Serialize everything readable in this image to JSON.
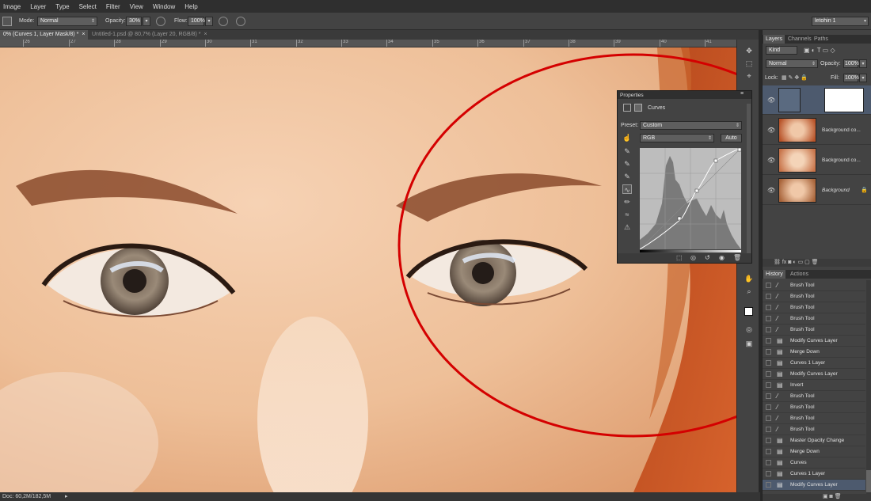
{
  "menu": [
    "Image",
    "Layer",
    "Type",
    "Select",
    "Filter",
    "View",
    "Window",
    "Help"
  ],
  "options": {
    "mode_label": "Mode:",
    "mode_value": "Normal",
    "opacity_label": "Opacity:",
    "opacity_value": "30%",
    "flow_label": "Flow:",
    "flow_value": "100%",
    "workspace": "letohin 1"
  },
  "tabs": [
    {
      "label": "0% (Curves 1, Layer Mask/8) *",
      "close": "×"
    },
    {
      "label": "Untitled-1.psd @ 80,7% (Layer 20, RGB/8) *",
      "close": "×"
    }
  ],
  "ruler_ticks": [
    "26",
    "27",
    "28",
    "29",
    "30",
    "31",
    "32",
    "33",
    "34",
    "35",
    "36",
    "37",
    "38",
    "39",
    "40",
    "41"
  ],
  "status": {
    "doc": "Doc: 60,2M/182,5M",
    "arrow": "▸"
  },
  "layers_panel": {
    "tabs": [
      "Layers",
      "Channels",
      "Paths"
    ],
    "kind": "Kind",
    "blend": "Normal",
    "opacity_label": "Opacity:",
    "opacity_value": "100%",
    "lock_label": "Lock:",
    "fill_label": "Fill:",
    "fill_value": "100%",
    "layers": [
      {
        "name": ""
      },
      {
        "name": "Background co..."
      },
      {
        "name": "Background co..."
      },
      {
        "name": "Background"
      }
    ]
  },
  "history_panel": {
    "tabs": [
      "History",
      "Actions"
    ],
    "items": [
      "Brush Tool",
      "Brush Tool",
      "Brush Tool",
      "Brush Tool",
      "Brush Tool",
      "Modify Curves Layer",
      "Merge Down",
      "Curves 1 Layer",
      "Modify Curves Layer",
      "Invert",
      "Brush Tool",
      "Brush Tool",
      "Brush Tool",
      "Brush Tool",
      "Master Opacity Change",
      "Merge Down",
      "Curves",
      "Curves 1 Layer",
      "Modify Curves Layer"
    ]
  },
  "properties": {
    "title": "Properties",
    "adjustment": "Curves",
    "preset_label": "Preset:",
    "preset_value": "Custom",
    "channel": "RGB",
    "auto": "Auto"
  },
  "colors": {
    "annotation_circle": "#d40000",
    "panel_bg": "#434343",
    "selected_row": "#4d5a6e"
  }
}
